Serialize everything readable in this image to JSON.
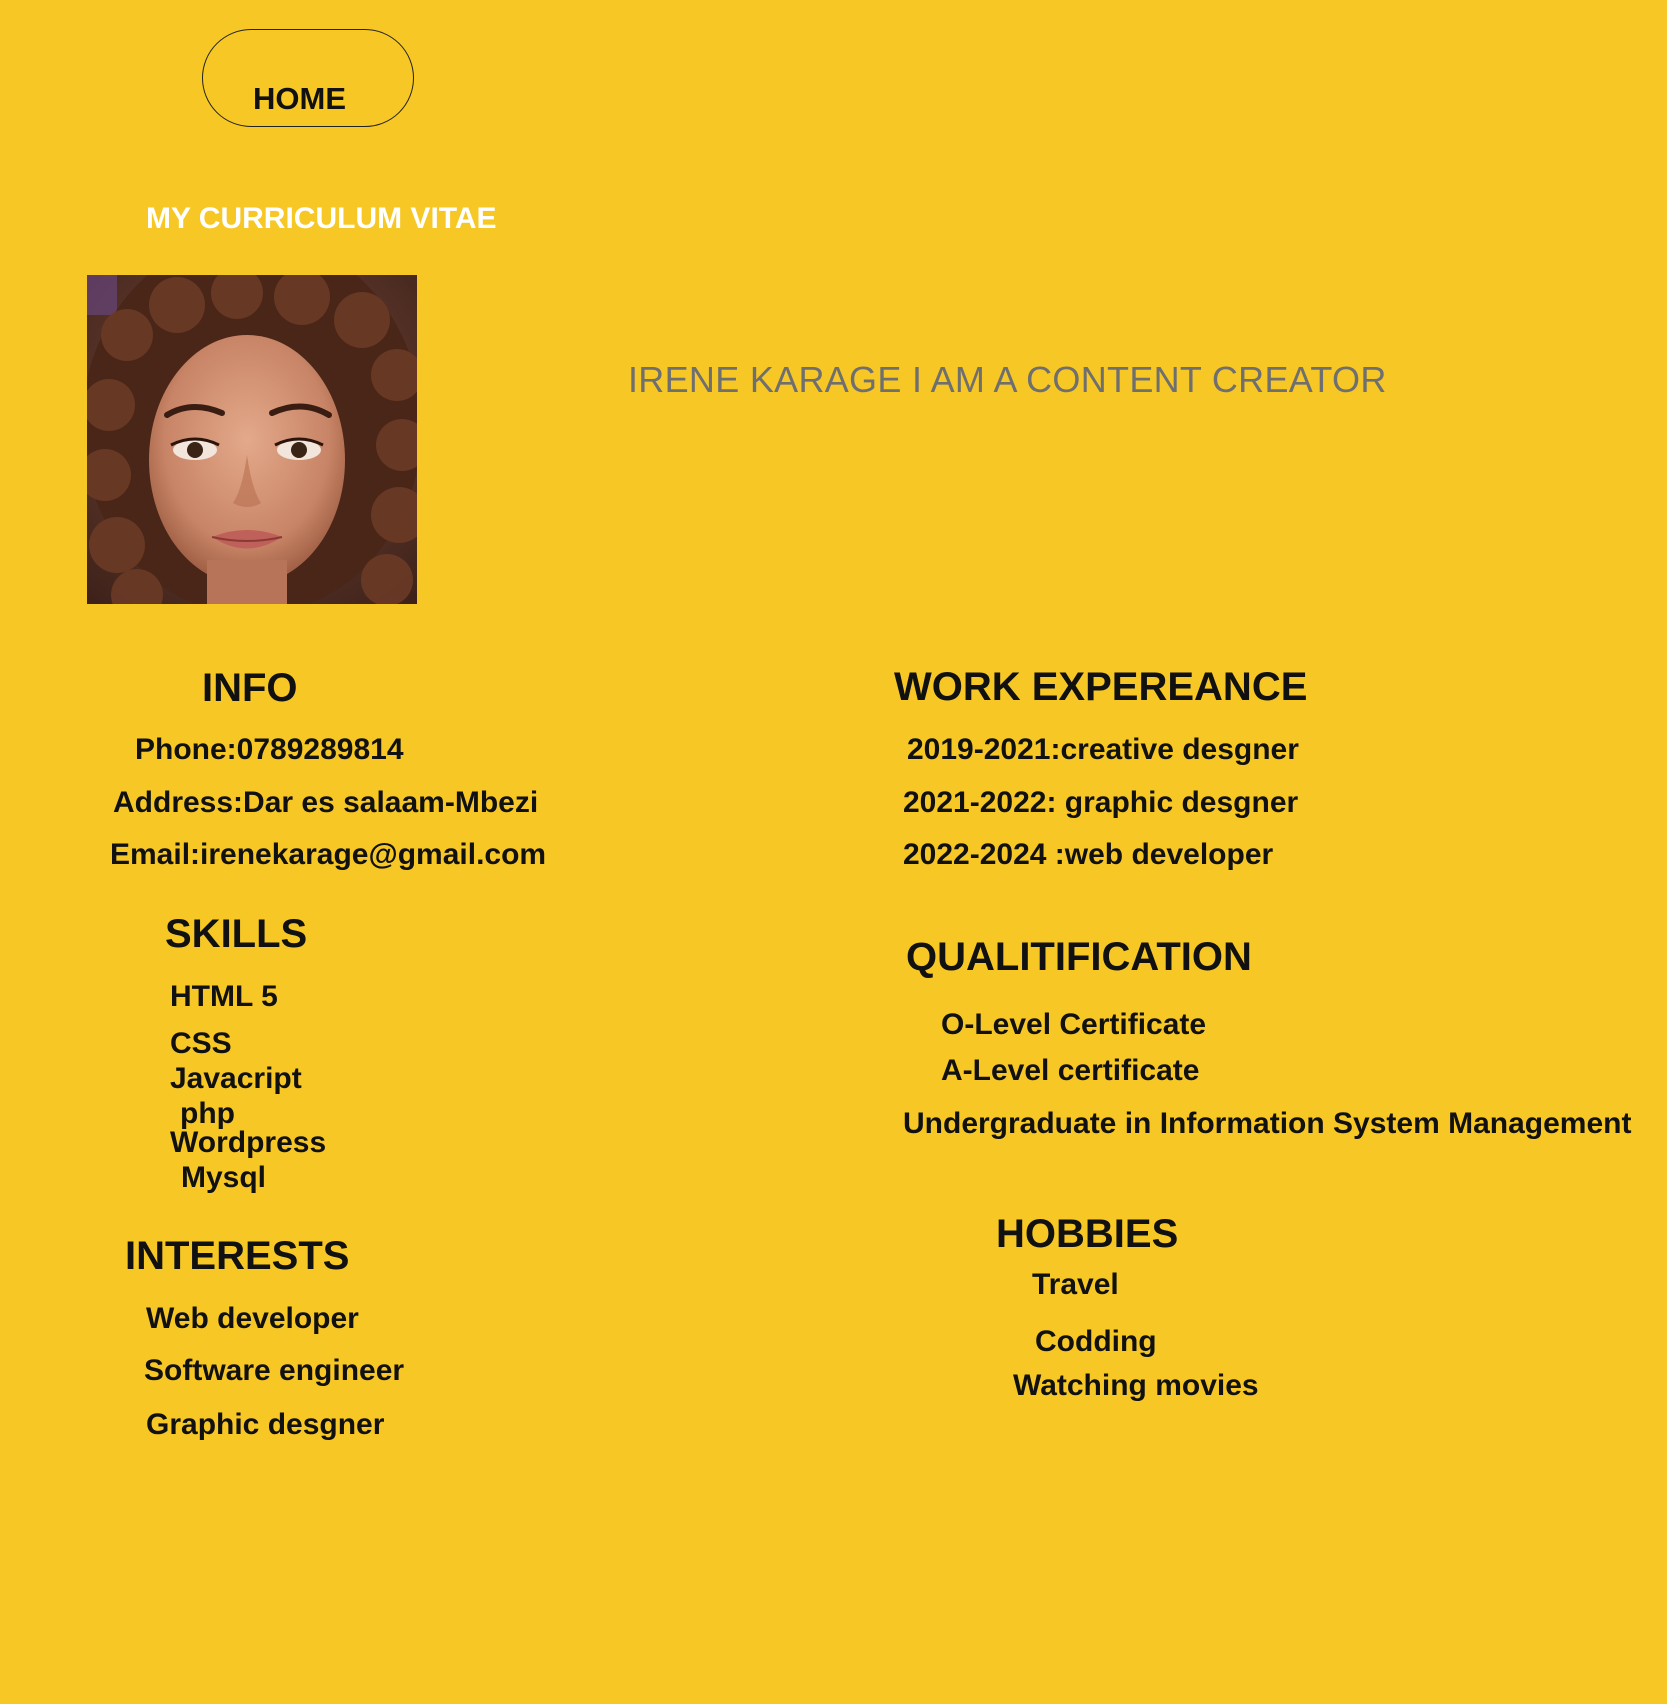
{
  "nav": {
    "home_label": "HOME"
  },
  "header": {
    "title": "MY CURRICULUM VITAE",
    "tagline": "IRENE KARAGE I AM A CONTENT CREATOR"
  },
  "profile_photo": {
    "icon": "person-portrait"
  },
  "info": {
    "heading": "INFO",
    "phone": "Phone:0789289814",
    "address": "Address:Dar es salaam-Mbezi",
    "email": "Email:irenekarage@gmail.com"
  },
  "skills": {
    "heading": "SKILLS",
    "items": [
      "HTML 5",
      "CSS",
      "Javacript",
      "php",
      "Wordpress",
      "Mysql"
    ]
  },
  "interests": {
    "heading": "INTERESTS",
    "items": [
      "Web developer",
      "Software engineer",
      "Graphic desgner"
    ]
  },
  "work": {
    "heading": "WORK EXPEREANCE",
    "items": [
      "2019-2021:creative desgner",
      "2021-2022: graphic desgner",
      "2022-2024 :web developer"
    ]
  },
  "qualification": {
    "heading": "QUALITIFICATION",
    "items": [
      "O-Level Certificate",
      "A-Level certificate",
      "Undergraduate in Information System Management"
    ]
  },
  "hobbies": {
    "heading": "HOBBIES",
    "items": [
      "Travel",
      "Codding",
      "Watching movies"
    ]
  },
  "colors": {
    "background": "#f7c825",
    "title": "#ffffff",
    "tagline": "#6f6f6f",
    "text": "#111111"
  }
}
